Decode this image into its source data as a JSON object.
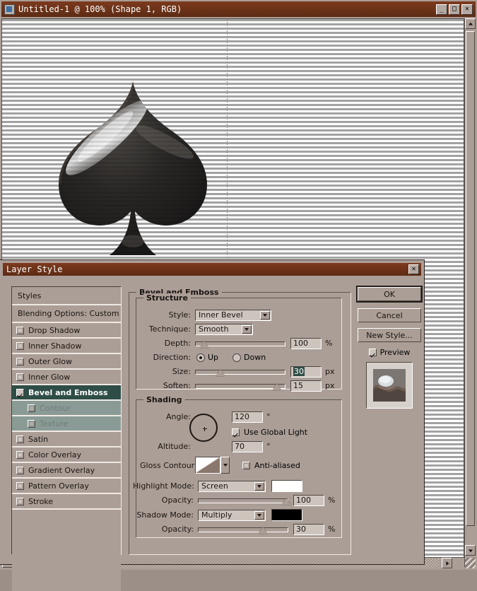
{
  "window": {
    "title": "Untitled-1 @ 100% (Shape 1, RGB)",
    "icon": "photoshop-document-icon",
    "buttons": {
      "minimize": "_",
      "maximize": "□",
      "close": "✕"
    }
  },
  "canvas": {
    "artwork": "spade-shape",
    "zoom": "100%"
  },
  "dialog": {
    "title": "Layer Style",
    "close_label": "✕",
    "styles_panel": {
      "header": "Styles",
      "blending_options": "Blending Options: Custom",
      "items": [
        {
          "label": "Drop Shadow",
          "checked": false,
          "selected": false,
          "child": false
        },
        {
          "label": "Inner Shadow",
          "checked": false,
          "selected": false,
          "child": false
        },
        {
          "label": "Outer Glow",
          "checked": false,
          "selected": false,
          "child": false
        },
        {
          "label": "Inner Glow",
          "checked": false,
          "selected": false,
          "child": false
        },
        {
          "label": "Bevel and Emboss",
          "checked": true,
          "selected": true,
          "child": false
        },
        {
          "label": "Contour",
          "checked": false,
          "selected": false,
          "child": true
        },
        {
          "label": "Texture",
          "checked": false,
          "selected": false,
          "child": true
        },
        {
          "label": "Satin",
          "checked": false,
          "selected": false,
          "child": false
        },
        {
          "label": "Color Overlay",
          "checked": false,
          "selected": false,
          "child": false
        },
        {
          "label": "Gradient Overlay",
          "checked": false,
          "selected": false,
          "child": false
        },
        {
          "label": "Pattern Overlay",
          "checked": false,
          "selected": false,
          "child": false
        },
        {
          "label": "Stroke",
          "checked": false,
          "selected": false,
          "child": false
        }
      ]
    },
    "panel": {
      "title": "Bevel and Emboss",
      "structure": {
        "legend": "Structure",
        "style_label": "Style:",
        "style_value": "Inner Bevel",
        "technique_label": "Technique:",
        "technique_value": "Smooth",
        "depth_label": "Depth:",
        "depth_value": "100",
        "depth_unit": "%",
        "depth_percent": 10,
        "direction_label": "Direction:",
        "direction_up": "Up",
        "direction_down": "Down",
        "direction_selected": "Up",
        "size_label": "Size:",
        "size_value": "30",
        "size_unit": "px",
        "size_percent": 28,
        "size_selected": true,
        "soften_label": "Soften:",
        "soften_value": "15",
        "soften_unit": "px",
        "soften_percent": 91
      },
      "shading": {
        "legend": "Shading",
        "angle_label": "Angle:",
        "angle_value": "120",
        "angle_unit": "°",
        "global_light_label": "Use Global Light",
        "global_light_checked": true,
        "altitude_label": "Altitude:",
        "altitude_value": "70",
        "altitude_unit": "°",
        "gloss_contour_label": "Gloss Contour:",
        "anti_aliased_label": "Anti-aliased",
        "anti_aliased_checked": false,
        "highlight_mode_label": "Highlight Mode:",
        "highlight_mode_value": "Screen",
        "highlight_color": "#ffffff",
        "highlight_opacity_label": "Opacity:",
        "highlight_opacity_value": "100",
        "highlight_opacity_unit": "%",
        "highlight_opacity_percent": 98,
        "shadow_mode_label": "Shadow Mode:",
        "shadow_mode_value": "Multiply",
        "shadow_color": "#000000",
        "shadow_opacity_label": "Opacity:",
        "shadow_opacity_value": "30",
        "shadow_opacity_unit": "%",
        "shadow_opacity_percent": 72
      }
    },
    "buttons": {
      "ok": "OK",
      "cancel": "Cancel",
      "new_style": "New Style...",
      "preview_label": "Preview",
      "preview_checked": true
    }
  },
  "colors": {
    "titlebar": "#6b3218",
    "face": "#ab9e97",
    "selected_row": "#2e4d46",
    "child_row": "#8a9b96",
    "field": "#cdc4bd"
  }
}
